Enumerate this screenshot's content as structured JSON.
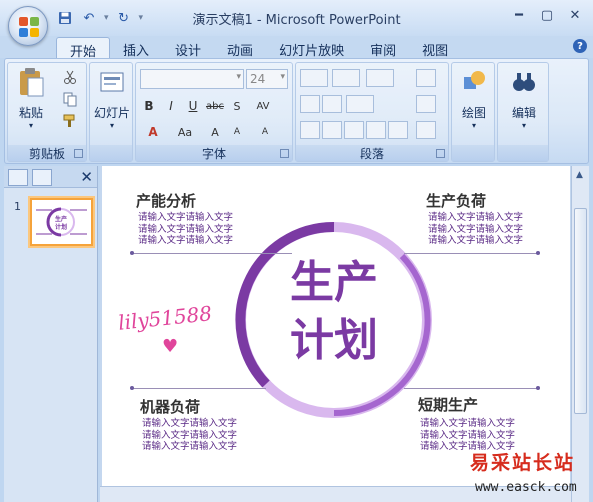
{
  "app": {
    "window_title": "演示文稿1 - Microsoft PowerPoint",
    "tabs": [
      "开始",
      "插入",
      "设计",
      "动画",
      "幻灯片放映",
      "审阅",
      "视图"
    ],
    "active_tab": "开始"
  },
  "ribbon": {
    "clipboard": {
      "paste_label": "粘贴",
      "group_label": "剪贴板"
    },
    "slides": {
      "slide_label": "幻灯片"
    },
    "font": {
      "font_name": "",
      "font_size": "24",
      "group_label": "字体"
    },
    "paragraph": {
      "group_label": "段落"
    },
    "drawing": {
      "label": "绘图"
    },
    "editing": {
      "label": "编辑"
    }
  },
  "panel": {
    "slide_number": "1"
  },
  "slide": {
    "center_title_line1": "生产",
    "center_title_line2": "计划",
    "sections": {
      "top_left": {
        "title": "产能分析",
        "lines": [
          "请输入文字请输入文字",
          "请输入文字请输入文字",
          "请输入文字请输入文字"
        ]
      },
      "top_right": {
        "title": "生产负荷",
        "lines": [
          "请输入文字请输入文字",
          "请输入文字请输入文字",
          "请输入文字请输入文字"
        ]
      },
      "bottom_left": {
        "title": "机器负荷",
        "lines": [
          "请输入文字请输入文字",
          "请输入文字请输入文字",
          "请输入文字请输入文字"
        ]
      },
      "bottom_right": {
        "title": "短期生产",
        "lines": [
          "请输入文字请输入文字",
          "请输入文字请输入文字",
          "请输入文字请输入文字"
        ]
      }
    },
    "watermark_handle": "lily51588",
    "heart": "♥"
  },
  "overlay": {
    "site_name": "易采站长站",
    "site_url": "www.easck.com"
  },
  "colors": {
    "accent_purple": "#7b3aa3",
    "light_purple": "#d9b8ee",
    "ribbon_blue": "#c4d9f1"
  }
}
